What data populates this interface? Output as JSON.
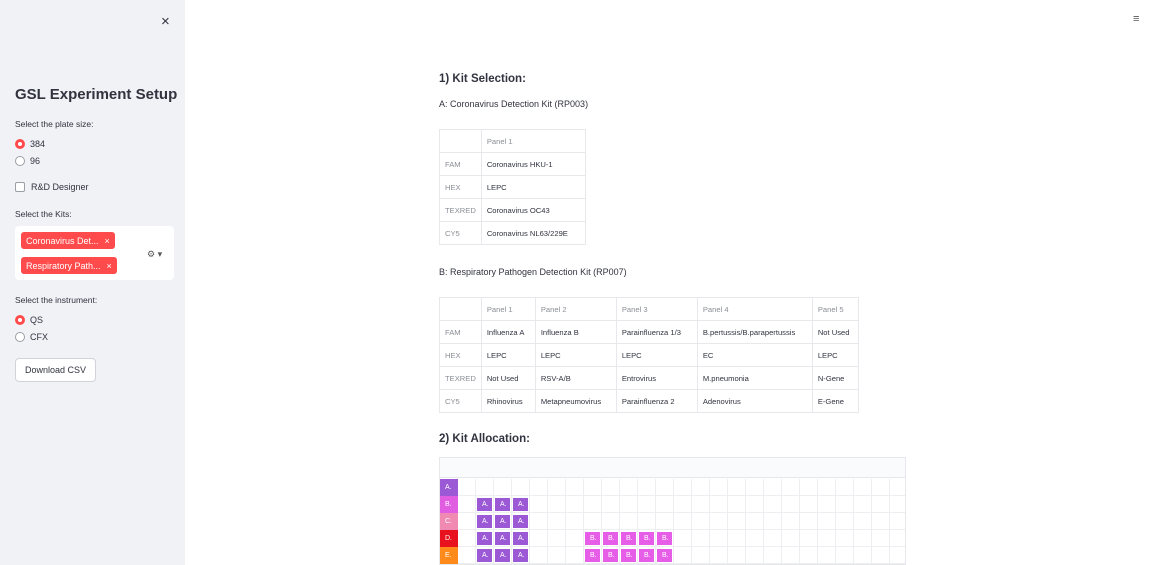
{
  "sidebar": {
    "close_label": "×",
    "title": "GSL Experiment Setup",
    "plate_size_label": "Select the plate size:",
    "plate_options": [
      {
        "label": "384",
        "selected": true
      },
      {
        "label": "96",
        "selected": false
      }
    ],
    "rnd_label": "R&D Designer",
    "kits_label": "Select the Kits:",
    "kits_selected": [
      "Coronavirus Det...",
      "Respiratory Path..."
    ],
    "tag_remove": "×",
    "ms_controls": "⚙ ▾",
    "instrument_label": "Select the instrument:",
    "instrument_options": [
      {
        "label": "QS",
        "selected": true
      },
      {
        "label": "CFX",
        "selected": false
      }
    ],
    "download_label": "Download CSV"
  },
  "header": {
    "menu_icon": "≡"
  },
  "main": {
    "section1_title": "1) Kit Selection:",
    "kitA": {
      "title": "A: Coronavirus Detection Kit (RP003)",
      "columns": [
        "",
        "Panel 1"
      ],
      "rows": [
        [
          "FAM",
          "Coronavirus HKU-1"
        ],
        [
          "HEX",
          "LEPC"
        ],
        [
          "TEXRED",
          "Coronavirus OC43"
        ],
        [
          "CY5",
          "Coronavirus NL63/229E"
        ]
      ]
    },
    "kitB": {
      "title": "B: Respiratory Pathogen Detection Kit (RP007)",
      "columns": [
        "",
        "Panel 1",
        "Panel 2",
        "Panel 3",
        "Panel 4",
        "Panel 5"
      ],
      "rows": [
        [
          "FAM",
          "Influenza A",
          "Influenza B",
          "Parainfluenza 1/3",
          "B.pertussis/B.parapertussis",
          "Not Used"
        ],
        [
          "HEX",
          "LEPC",
          "LEPC",
          "LEPC",
          "EC",
          "LEPC"
        ],
        [
          "TEXRED",
          "Not Used",
          "RSV-A/B",
          "Entrovirus",
          "M.pneumonia",
          "N-Gene"
        ],
        [
          "CY5",
          "Rhinovirus",
          "Metapneumovirus",
          "Parainfluenza 2",
          "Adenovirus",
          "E-Gene"
        ]
      ]
    },
    "section2_title": "2) Kit Allocation:",
    "plate": {
      "row_labels": [
        "A.",
        "B.",
        "C.",
        "D.",
        "E."
      ],
      "row_colors": [
        "#9b59d6",
        "#e05ce0",
        "#f08ab3",
        "#e8111e",
        "#ff8a1c"
      ],
      "well_label_a": "A.",
      "well_label_b": "B.",
      "color_a": "#9b59d6",
      "color_b": "#e65ee8"
    }
  }
}
